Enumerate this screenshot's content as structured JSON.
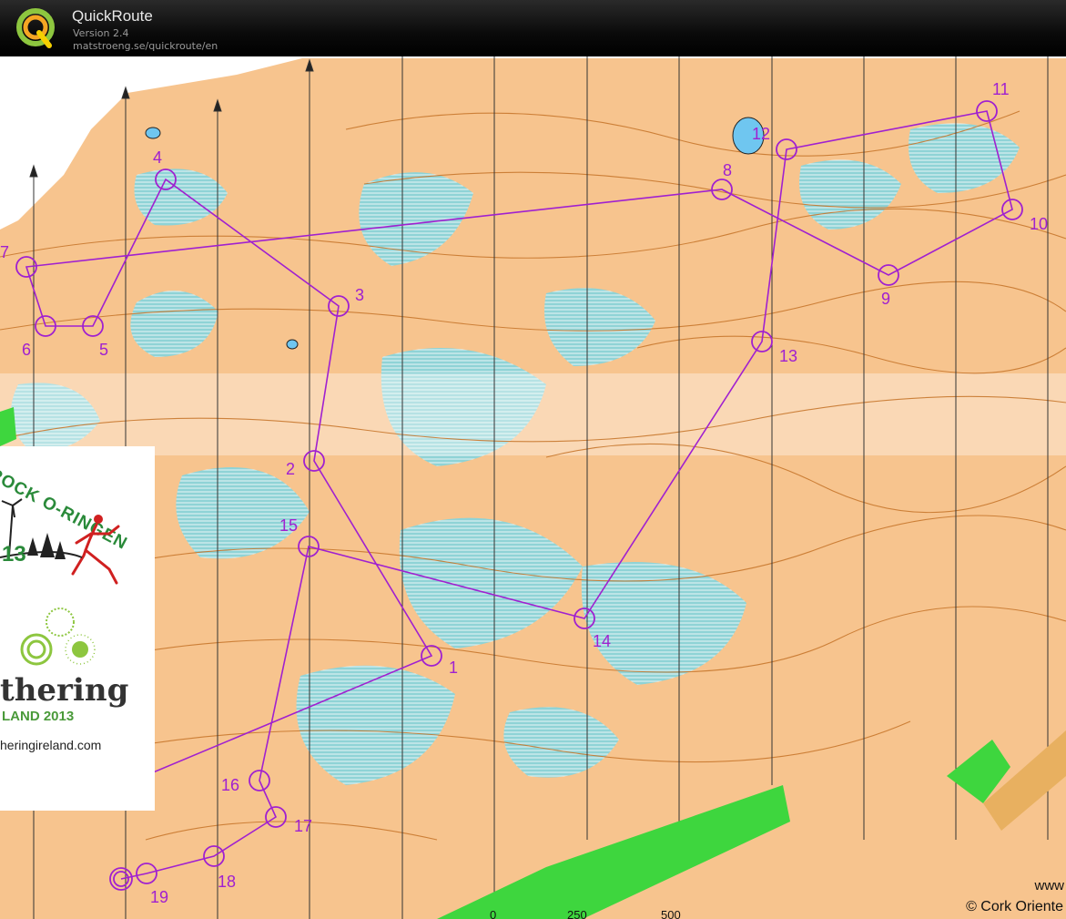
{
  "app": {
    "name": "QuickRoute",
    "version": "Version 2.4",
    "url": "matstroeng.se/quickroute/en",
    "logo_letter": "Q"
  },
  "course": {
    "route_color": "#a020d0",
    "start_label": "",
    "controls": [
      {
        "number": "1"
      },
      {
        "number": "2"
      },
      {
        "number": "3"
      },
      {
        "number": "4"
      },
      {
        "number": "5"
      },
      {
        "number": "6"
      },
      {
        "number": "7"
      },
      {
        "number": "8"
      },
      {
        "number": "9"
      },
      {
        "number": "10"
      },
      {
        "number": "11"
      },
      {
        "number": "12"
      },
      {
        "number": "13"
      },
      {
        "number": "14"
      },
      {
        "number": "15"
      },
      {
        "number": "16"
      },
      {
        "number": "17"
      },
      {
        "number": "18"
      },
      {
        "number": "19"
      }
    ]
  },
  "map": {
    "colors": {
      "open_land": "#f7c48e",
      "contour": "#c8782e",
      "vegetation": "#8fd3d6",
      "green_field": "#3ed63e",
      "north_lines": "#222222"
    },
    "event_panel": {
      "oringen_text": "ROCK O-RINGEN",
      "oringen_year": "13",
      "gathering_word": "thering",
      "gathering_sub": "LAND 2013",
      "gathering_url": "heringireland.com"
    },
    "copyright": "© Cork Oriente",
    "www": "www",
    "scale": {
      "zero": "0",
      "mid": "250",
      "end": "500"
    }
  }
}
